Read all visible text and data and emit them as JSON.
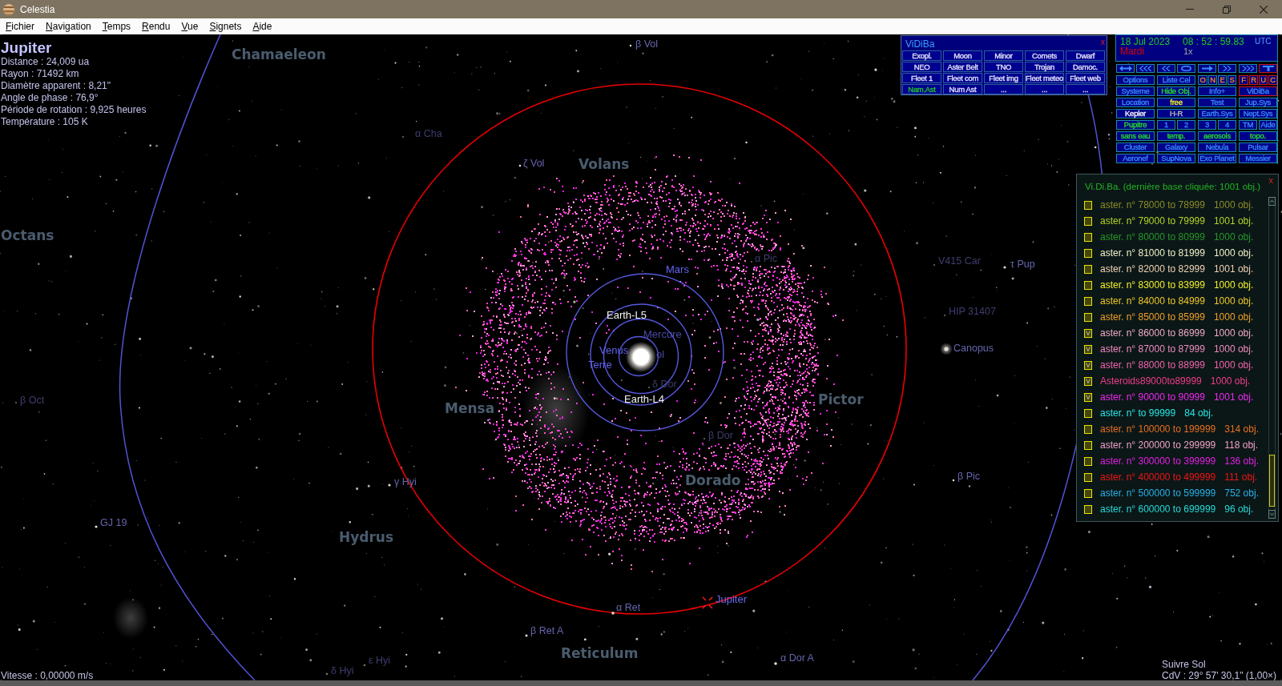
{
  "window": {
    "title": "Celestia"
  },
  "menu": [
    "Fichier",
    "Navigation",
    "Temps",
    "Rendu",
    "Vue",
    "Signets",
    "Aide"
  ],
  "object_info": {
    "name": "Jupiter",
    "lines": [
      "Distance : 24,009 ua",
      "Rayon : 71492 km",
      "Diamètre apparent : 8,21\"",
      "Angle de phase : 76,9°",
      "Période de rotation : 9,925 heures",
      "Température : 105 K"
    ]
  },
  "constellations": [
    "Chamaeleon",
    "Volans",
    "Octans",
    "Pictor",
    "Mensa",
    "Dorado",
    "Hydrus",
    "Reticulum"
  ],
  "star_labels": [
    {
      "name": "β Vol",
      "faint": false
    },
    {
      "name": "α Cha",
      "faint": true
    },
    {
      "name": "ζ Vol",
      "faint": false
    },
    {
      "name": "α Pic",
      "faint": true
    },
    {
      "name": "V415 Car",
      "faint": true
    },
    {
      "name": "τ Pup",
      "faint": false
    },
    {
      "name": "HIP 31407",
      "faint": true
    },
    {
      "name": "Canopus",
      "faint": false
    },
    {
      "name": "δ Dor",
      "faint": true
    },
    {
      "name": "β Oct",
      "faint": true
    },
    {
      "name": "β Dor",
      "faint": true
    },
    {
      "name": "β Pic",
      "faint": false
    },
    {
      "name": "γ Hyi",
      "faint": false
    },
    {
      "name": "GJ 19",
      "faint": false
    },
    {
      "name": "α Ret",
      "faint": false
    },
    {
      "name": "β Ret A",
      "faint": false
    },
    {
      "name": "α Dor A",
      "faint": false
    },
    {
      "name": "ε Hyi",
      "faint": true
    },
    {
      "name": "δ Hyi",
      "faint": true
    }
  ],
  "bodies": [
    {
      "name": "Mars",
      "kind": "planet",
      "faint": false
    },
    {
      "name": "Earth-L5",
      "kind": "point",
      "faint": false
    },
    {
      "name": "Mercure",
      "kind": "planet",
      "faint": true
    },
    {
      "name": "Venus",
      "kind": "planet",
      "faint": false
    },
    {
      "name": "ol",
      "kind": "planet",
      "faint": true
    },
    {
      "name": "Terre",
      "kind": "planet",
      "faint": false
    },
    {
      "name": "Earth-L4",
      "kind": "point",
      "faint": false
    },
    {
      "name": "Jupiter",
      "kind": "target",
      "faint": false
    }
  ],
  "vidiba": {
    "title": "ViDiBa",
    "close": "x",
    "buttons": [
      {
        "label": "Exopl.",
        "selected": false
      },
      {
        "label": "Moon",
        "selected": false
      },
      {
        "label": "Minor",
        "selected": false
      },
      {
        "label": "Comets",
        "selected": false
      },
      {
        "label": "Dwarf",
        "selected": false
      },
      {
        "label": "NEO",
        "selected": false
      },
      {
        "label": "Aster Belt",
        "selected": false
      },
      {
        "label": "TNO",
        "selected": false
      },
      {
        "label": "Trojan",
        "selected": false
      },
      {
        "label": "Damoc.",
        "selected": false
      },
      {
        "label": "Fleet 1",
        "selected": false
      },
      {
        "label": "Fleet com",
        "selected": false
      },
      {
        "label": "Fleet img",
        "selected": false
      },
      {
        "label": "Fleet meteo",
        "selected": false
      },
      {
        "label": "Fleet web",
        "selected": false
      },
      {
        "label": "Nam.Ast",
        "selected": true
      },
      {
        "label": "Num Ast",
        "selected": false
      },
      {
        "label": "...",
        "selected": false
      },
      {
        "label": "...",
        "selected": false
      },
      {
        "label": "...",
        "selected": false
      }
    ]
  },
  "time_panel": {
    "date": "18 Jul 2023",
    "time": "08 : 52 : 59.83",
    "zone": "UTC",
    "weekday": "Mardi",
    "rate": "1x"
  },
  "time_controls": [
    {
      "kind": "double_arrow",
      "active": false
    },
    {
      "kind": "triple_left",
      "active": false
    },
    {
      "kind": "double_left",
      "active": false
    },
    {
      "kind": "oval",
      "active": false
    },
    {
      "kind": "right_arrow",
      "active": false
    },
    {
      "kind": "double_right",
      "active": false
    },
    {
      "kind": "triple_right",
      "active": false
    },
    {
      "kind": "tee",
      "active": true
    }
  ],
  "control_grid": [
    [
      [
        {
          "label": "Options",
          "kind": "command",
          "active": false
        }
      ],
      [
        {
          "label": "Liste Cel",
          "kind": "command",
          "active": false
        }
      ],
      [
        {
          "label": "O",
          "kind": "letter",
          "active": false
        },
        {
          "label": "N",
          "kind": "letter",
          "active": false
        },
        {
          "label": "E",
          "kind": "letter",
          "active": false
        },
        {
          "label": "S",
          "kind": "letter",
          "active": false
        }
      ],
      [
        {
          "label": "F",
          "kind": "letter",
          "active": true
        },
        {
          "label": "R",
          "kind": "letter",
          "active": true
        },
        {
          "label": "U",
          "kind": "letter",
          "active": true
        },
        {
          "label": "C",
          "kind": "letter",
          "active": true
        }
      ]
    ],
    [
      [
        {
          "label": "Systeme",
          "kind": "command",
          "active": false
        }
      ],
      [
        {
          "label": "Hide Obj.",
          "kind": "toggle",
          "active": false
        }
      ],
      [
        {
          "label": "Info+",
          "kind": "command",
          "active": false
        }
      ],
      [
        {
          "label": "ViDiBa",
          "kind": "command",
          "active": true
        }
      ]
    ],
    [
      [
        {
          "label": "Location",
          "kind": "command",
          "active": false
        }
      ],
      [
        {
          "label": "free",
          "kind": "mode",
          "active": false
        }
      ],
      [
        {
          "label": "Test",
          "kind": "command",
          "active": false
        }
      ],
      [
        {
          "label": "Jup.Sys",
          "kind": "command",
          "active": false
        }
      ]
    ],
    [
      [
        {
          "label": "Kepler",
          "kind": "plain",
          "active": false
        }
      ],
      [
        {
          "label": "H-R",
          "kind": "muted",
          "active": false
        }
      ],
      [
        {
          "label": "Earth.Sys",
          "kind": "command",
          "active": false
        }
      ],
      [
        {
          "label": "Nept.Sys",
          "kind": "command",
          "active": false
        }
      ]
    ],
    [
      [
        {
          "label": "Pupitre",
          "kind": "toggle",
          "active": false
        }
      ],
      [
        {
          "label": "1",
          "kind": "command",
          "active": false
        },
        {
          "label": "2",
          "kind": "command",
          "active": false
        }
      ],
      [
        {
          "label": "3",
          "kind": "command",
          "active": false
        },
        {
          "label": "4",
          "kind": "command",
          "active": false
        }
      ],
      [
        {
          "label": "TM",
          "kind": "command",
          "active": false
        },
        {
          "label": "Aide",
          "kind": "command",
          "active": false
        }
      ]
    ],
    [
      [
        {
          "label": "sans eau",
          "kind": "toggle",
          "active": false
        }
      ],
      [
        {
          "label": "temp.",
          "kind": "toggle",
          "active": false
        }
      ],
      [
        {
          "label": "aerosols",
          "kind": "toggle",
          "active": false
        }
      ],
      [
        {
          "label": "topo.",
          "kind": "toggle",
          "active": false
        }
      ]
    ],
    [
      [
        {
          "label": "Cluster",
          "kind": "command",
          "active": false
        }
      ],
      [
        {
          "label": "Galaxy",
          "kind": "command",
          "active": false
        }
      ],
      [
        {
          "label": "Nebula",
          "kind": "command",
          "active": false
        }
      ],
      [
        {
          "label": "Pulsar",
          "kind": "command",
          "active": false
        }
      ]
    ],
    [
      [
        {
          "label": "Aeronef",
          "kind": "command",
          "active": false
        }
      ],
      [
        {
          "label": "SupNova",
          "kind": "command",
          "active": false
        }
      ],
      [
        {
          "label": "Exo Planet",
          "kind": "command",
          "active": false
        }
      ],
      [
        {
          "label": "Messier",
          "kind": "command",
          "active": false
        }
      ]
    ]
  ],
  "catalog": {
    "title": "Vi.Di.Ba. (dernière base cliquée: 1001 obj.)",
    "close": "x",
    "rows": [
      {
        "label": "aster. n° 78000 to 78999",
        "count": "1000 obj.",
        "color": "#8c8c28",
        "checked": false
      },
      {
        "label": "aster. n° 79000 to 79999",
        "count": "1001 obj.",
        "color": "#b4d228",
        "checked": false
      },
      {
        "label": "aster. n° 80000 to 80999",
        "count": "1000 obj.",
        "color": "#289628",
        "checked": false
      },
      {
        "label": "aster. n° 81000 to 81999",
        "count": "1000 obj.",
        "color": "#f0f0c8",
        "checked": false
      },
      {
        "label": "aster. n° 82000 to 82999",
        "count": "1001 obj.",
        "color": "#f0d2b4",
        "checked": false
      },
      {
        "label": "aster. n° 83000 to 83999",
        "count": "1000 obj.",
        "color": "#f0f028",
        "checked": false
      },
      {
        "label": "aster. n° 84000 to 84999",
        "count": "1000 obj.",
        "color": "#f0c828",
        "checked": false
      },
      {
        "label": "aster. n° 85000 to 85999",
        "count": "1000 obj.",
        "color": "#f0a028",
        "checked": false
      },
      {
        "label": "aster. n° 86000 to 86999",
        "count": "1000 obj.",
        "color": "#f0aac8",
        "checked": true
      },
      {
        "label": "aster. n° 87000 to 87999",
        "count": "1000 obj.",
        "color": "#f08cbe",
        "checked": true
      },
      {
        "label": "aster. n° 88000 to 88999",
        "count": "1000 obj.",
        "color": "#f064aa",
        "checked": true
      },
      {
        "label": "Asteroids89000to89999",
        "count": "1000 obj.",
        "color": "#f03c8c",
        "checked": true
      },
      {
        "label": "aster. n° 90000 to 90999",
        "count": "1001 obj.",
        "color": "#f028f0",
        "checked": true
      },
      {
        "label": "aster. n° to 99999",
        "count": "84 obj.",
        "color": "#28e6e6",
        "checked": false
      },
      {
        "label": "aster. n° 100000 to 199999",
        "count": "314 obj.",
        "color": "#e87020",
        "checked": false
      },
      {
        "label": "aster. n° 200000 to 299999",
        "count": "118 obj.",
        "color": "#f0a0c8",
        "checked": false
      },
      {
        "label": "aster. n° 300000 to 399999",
        "count": "136 obj.",
        "color": "#e020e0",
        "checked": false
      },
      {
        "label": "aster. n° 400000 to 499999",
        "count": "111 obj.",
        "color": "#f01414",
        "checked": false
      },
      {
        "label": "aster. n° 500000 to 599999",
        "count": "752 obj.",
        "color": "#28b0e8",
        "checked": false
      },
      {
        "label": "aster. n° 600000 to 699999",
        "count": "96 obj.",
        "color": "#28d8d8",
        "checked": false
      }
    ]
  },
  "status": {
    "speed": "Vitesse : 0,00000 m/s",
    "follow": "Suivre Sol",
    "fov": "CdV : 29° 57' 30,1\" (1,00×)"
  }
}
